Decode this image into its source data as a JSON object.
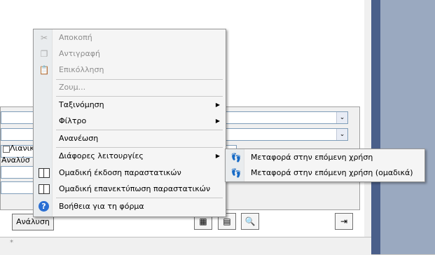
{
  "background_form": {
    "partial_label_1": "Λιανικ",
    "partial_label_2": "Αναλύσ",
    "analysis_button": "Ανάλυση",
    "combo_arrow": "⌄",
    "nav_glyph": "*"
  },
  "context_menu": {
    "items": [
      {
        "label": "Αποκοπή",
        "icon": "scissors-icon",
        "disabled": true
      },
      {
        "label": "Αντιγραφή",
        "icon": "copy-icon",
        "disabled": true
      },
      {
        "label": "Επικόλληση",
        "icon": "paste-icon",
        "disabled": true
      },
      {
        "label": "Ζουμ...",
        "disabled": true
      },
      {
        "label": "Ταξινόμηση",
        "has_submenu": true
      },
      {
        "label": "Φίλτρο",
        "has_submenu": true
      },
      {
        "label": "Ανανέωση"
      },
      {
        "label": "Διάφορες λειτουργίες",
        "has_submenu": true
      },
      {
        "label": "Ομαδική έκδοση παραστατικών",
        "icon": "book-icon"
      },
      {
        "label": "Ομαδική επανεκτύπωση παραστατικών",
        "icon": "book-icon"
      },
      {
        "label": "Βοήθεια για τη φόρμα",
        "icon": "help-icon"
      }
    ],
    "arrow_glyph": "▶"
  },
  "submenu": {
    "items": [
      {
        "label": "Μεταφορά στην επόμενη χρήση",
        "icon": "footprints-icon"
      },
      {
        "label": "Μεταφορά στην επόμενη χρήση (ομαδικά)",
        "icon": "footprints-icon"
      }
    ]
  },
  "icons": {
    "scissors": "✂",
    "copy": "❐",
    "paste": "📋",
    "help": "?",
    "footprints": "👣"
  }
}
